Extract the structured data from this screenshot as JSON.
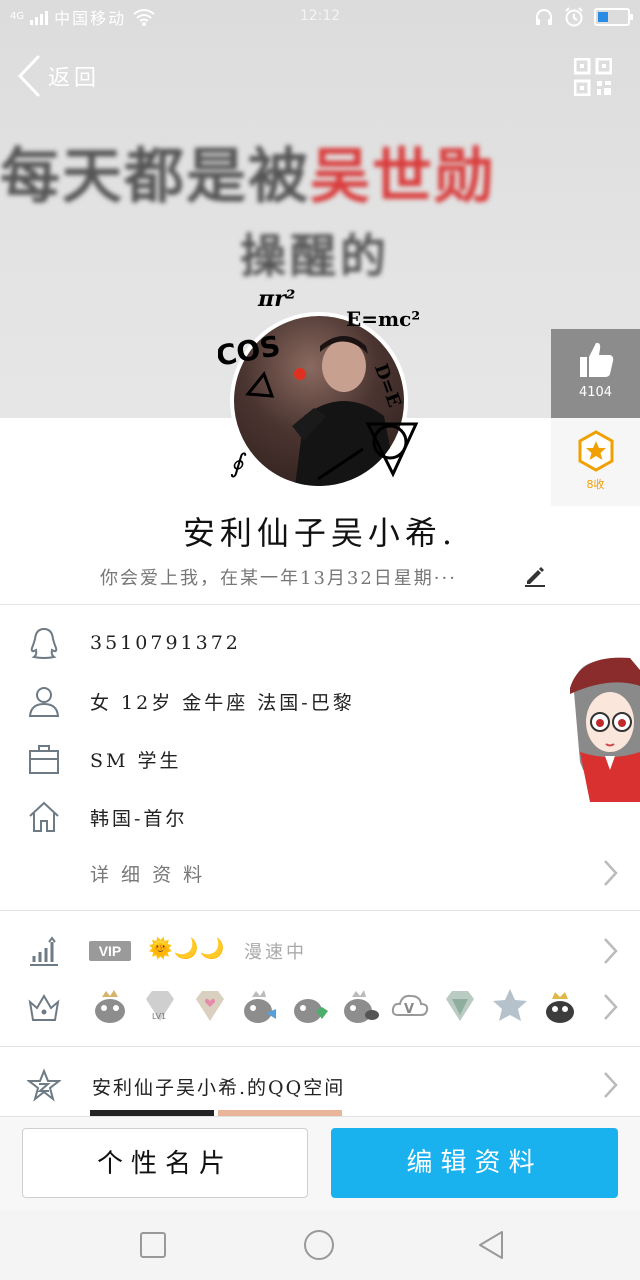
{
  "status_bar": {
    "signal_text": "4G",
    "carrier": "中国移动",
    "time": "12:12",
    "battery_level": 0.35,
    "icons": [
      "signal-icon",
      "wifi-icon",
      "headset-icon",
      "alarm-icon",
      "battery-icon"
    ]
  },
  "header": {
    "back_label": "返回",
    "qr_icon": "qr-code-icon"
  },
  "cover": {
    "line1_dark": "每天都是被",
    "line1_red": "吴世勋",
    "line2": "操醒的"
  },
  "avatar_doodles": [
    "πr²",
    "COS",
    "E=mc²",
    "D=E",
    "∮"
  ],
  "side_buttons": {
    "like_icon": "thumbs-up-icon",
    "like_count": "4104",
    "favorite_icon": "star-badge-icon",
    "favorite_label": "8收"
  },
  "profile": {
    "nickname": "安利仙子吴小希.",
    "signature": "你会爱上我，在某一年13月32日星期···"
  },
  "info": {
    "qq_number": "3510791372",
    "personal": "女  12岁  金牛座  法国-巴黎",
    "job": "SM 学生",
    "hometown": "韩国-首尔",
    "details_link": "详 细 资 料"
  },
  "vip": {
    "badge": "VIP",
    "level_icons": "🌞🌙🌙",
    "status": "漫速中"
  },
  "badges": [
    "penguin-crown-badge",
    "diamond-lv1-badge",
    "heart-diamond-badge",
    "penguin-fish-badge",
    "penguin-gem-badge",
    "penguin-game-badge",
    "v-cloud-badge",
    "green-diamond-badge",
    "star-badge",
    "black-penguin-crown-badge"
  ],
  "qzone": {
    "label": "安利仙子吴小希.的QQ空间"
  },
  "actions": {
    "card_label": "个性名片",
    "edit_label": "编辑资料"
  },
  "colors": {
    "accent": "#19b1ee",
    "cover_red": "#d93c3c",
    "like_panel": "#8c8c8c",
    "favorite_gold": "#f0a000"
  }
}
